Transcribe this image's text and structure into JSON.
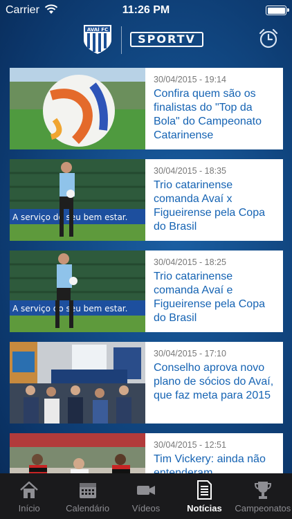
{
  "status_bar": {
    "carrier": "Carrier",
    "time": "11:26 PM"
  },
  "header": {
    "club_name": "AVAÍ FC",
    "partner_logo_text": "SPORTV"
  },
  "articles": [
    {
      "date": "30/04/2015 - 19:14",
      "title": "Confira quem são os finalistas do \"Top da Bola\" do Campeonato Catarinense",
      "thumb_caption": ""
    },
    {
      "date": "30/04/2015 - 18:35",
      "title": "Trio catarinense comanda Avaí x Figueirense pela Copa do Brasil",
      "thumb_caption": "A serviço do seu bem estar."
    },
    {
      "date": "30/04/2015 - 18:25",
      "title": "Trio catarinense comanda Avaí e Figueirense pela Copa do Brasil",
      "thumb_caption": "A serviço do seu bem estar."
    },
    {
      "date": "30/04/2015 - 17:10",
      "title": "Conselho aprova novo plano de sócios do Avaí, que faz meta para 2015",
      "thumb_caption": ""
    },
    {
      "date": "30/04/2015 - 12:51",
      "title": "Tim Vickery: ainda não entenderam",
      "thumb_caption": ""
    }
  ],
  "tabs": [
    {
      "label": "Início",
      "icon": "home-icon"
    },
    {
      "label": "Calendário",
      "icon": "calendar-icon"
    },
    {
      "label": "Vídeos",
      "icon": "video-camera-icon"
    },
    {
      "label": "Notícias",
      "icon": "news-document-icon",
      "active": true
    },
    {
      "label": "Campeonatos",
      "icon": "trophy-icon"
    }
  ],
  "colors": {
    "accent": "#1563b3",
    "background": "#124a86",
    "tabbar": "#1a1a1c"
  }
}
